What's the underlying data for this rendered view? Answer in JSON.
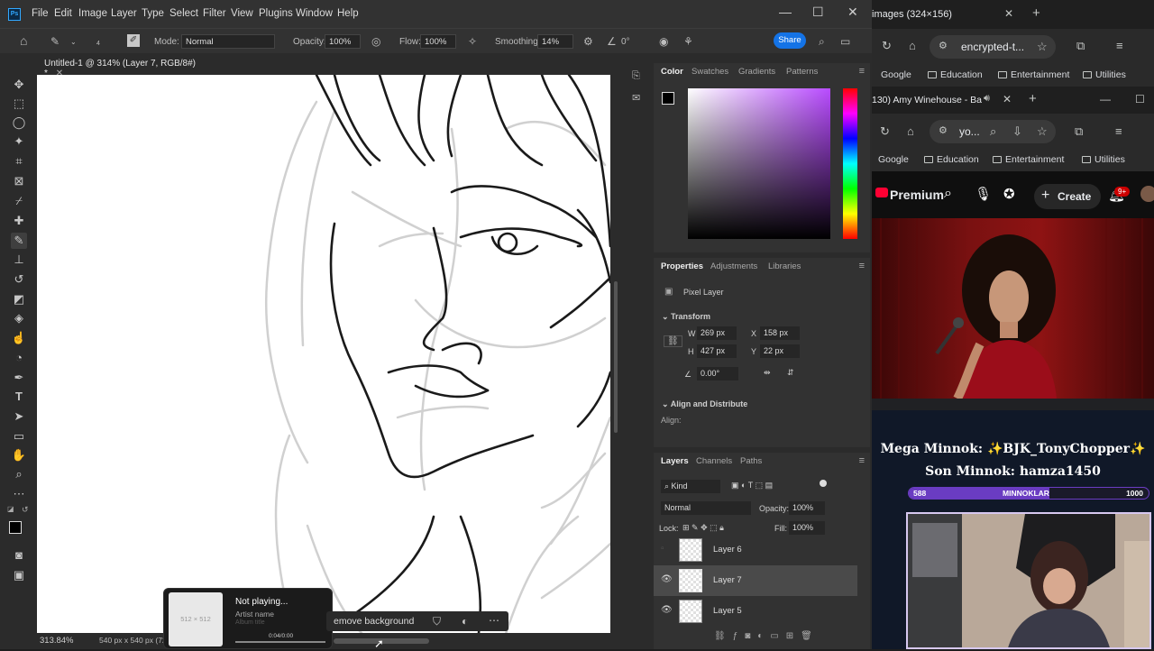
{
  "ps": {
    "logo": "Ps",
    "menu": [
      "File",
      "Edit",
      "Image",
      "Layer",
      "Type",
      "Select",
      "Filter",
      "View",
      "Plugins",
      "Window",
      "Help"
    ],
    "options": {
      "brush_size": "4",
      "mode_label": "Mode:",
      "mode_value": "Normal",
      "opacity_label": "Opacity:",
      "opacity_value": "100%",
      "flow_label": "Flow:",
      "flow_value": "100%",
      "smoothing_label": "Smoothing:",
      "smoothing_value": "14%",
      "angle_value": "0°",
      "share_label": "Share"
    },
    "document_tab": "Untitled-1 @ 314% (Layer 7, RGB/8#) *",
    "status": {
      "zoom": "313.84%",
      "doc_size": "540 px x 540 px (72"
    },
    "context_bar": {
      "remove_bg": "emove background"
    }
  },
  "color_panel": {
    "tabs": [
      "Color",
      "Swatches",
      "Gradients",
      "Patterns"
    ],
    "active_tab": "Color"
  },
  "properties_panel": {
    "tabs": [
      "Properties",
      "Adjustments",
      "Libraries"
    ],
    "type_label": "Pixel Layer",
    "transform_label": "Transform",
    "w_label": "W",
    "w_value": "269 px",
    "h_label": "H",
    "h_value": "427 px",
    "x_label": "X",
    "x_value": "158 px",
    "y_label": "Y",
    "y_value": "22 px",
    "angle_value": "0.00°",
    "align_label": "Align and Distribute",
    "align_sub": "Align:"
  },
  "layers_panel": {
    "tabs": [
      "Layers",
      "Channels",
      "Paths"
    ],
    "kind_label": "Kind",
    "blend_mode": "Normal",
    "opacity_label": "Opacity:",
    "opacity_value": "100%",
    "lock_label": "Lock:",
    "fill_label": "Fill:",
    "fill_value": "100%",
    "layers": [
      {
        "name": "Layer 6",
        "visible": false,
        "selected": false
      },
      {
        "name": "Layer 7",
        "visible": true,
        "selected": true
      },
      {
        "name": "Layer 5",
        "visible": true,
        "selected": false
      }
    ]
  },
  "media_popup": {
    "thumb_text": "512 × 512",
    "title": "Not playing...",
    "artist": "Artist name",
    "album": "Album title",
    "time": "0:04/0:00"
  },
  "browser": {
    "tab1_title": "images (324×156)",
    "addr1": "encrypted-t...",
    "bookmarks": [
      "Google",
      "Education",
      "Entertainment",
      "Utilities"
    ],
    "tab2_title": "130) Amy Winehouse - Ba",
    "addr2": "yo...",
    "yt_premium": "Premium",
    "yt_create": "Create",
    "notif_count": "9+",
    "stream_line1": "Mega Minnok: ✨BJK_TonyChopper✨",
    "stream_line2": "Son Minnok: hamza1450",
    "bar_left": "588",
    "bar_mid": "MINNOKLAR",
    "bar_right": "1000",
    "bar_progress": 0.588
  },
  "colors": {
    "ps_bg": "#2b2b2b",
    "ps_panel": "#323232",
    "accent_blue": "#1473e6",
    "yt_red": "#ff0033",
    "stream_purple": "#6a3cc2"
  }
}
